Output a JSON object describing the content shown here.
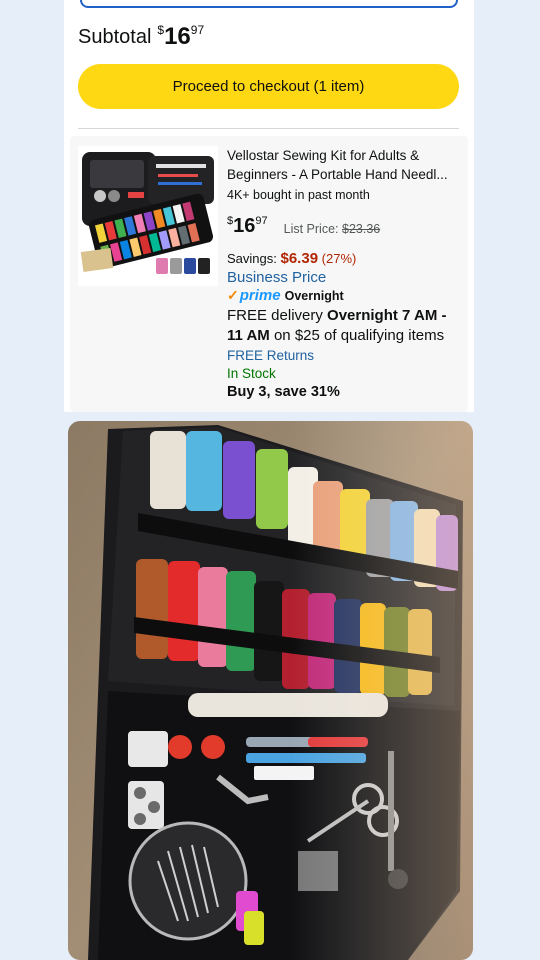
{
  "cart": {
    "subtotal_label": "Subtotal",
    "subtotal_currency": "$",
    "subtotal_whole": "16",
    "subtotal_fraction": "97",
    "checkout_label": "Proceed to checkout (1 item)"
  },
  "item": {
    "title": "Vellostar Sewing Kit for Adults & Beginners - A Portable Hand Needl...",
    "bought": "4K+ bought in past month",
    "price_currency": "$",
    "price_whole": "16",
    "price_fraction": "97",
    "list_label": "List Price:",
    "list_price": "$23.36",
    "savings_label": "Savings:",
    "savings_amount": "$6.39",
    "savings_percent": "(27%)",
    "business_price": "Business Price",
    "prime_label": "prime",
    "prime_speed": "Overnight",
    "delivery_prefix": "FREE delivery",
    "delivery_window": "Overnight 7 AM - 11 AM",
    "delivery_suffix": "on $25 of qualifying items",
    "returns": "FREE Returns",
    "stock": "In Stock",
    "promo": "Buy 3, save 31%"
  },
  "colors": {
    "checkout_button": "#ffd814",
    "link_blue": "#2162a1",
    "savings_red": "#b12704",
    "stock_green": "#007600",
    "prime_blue": "#1a98ff"
  }
}
